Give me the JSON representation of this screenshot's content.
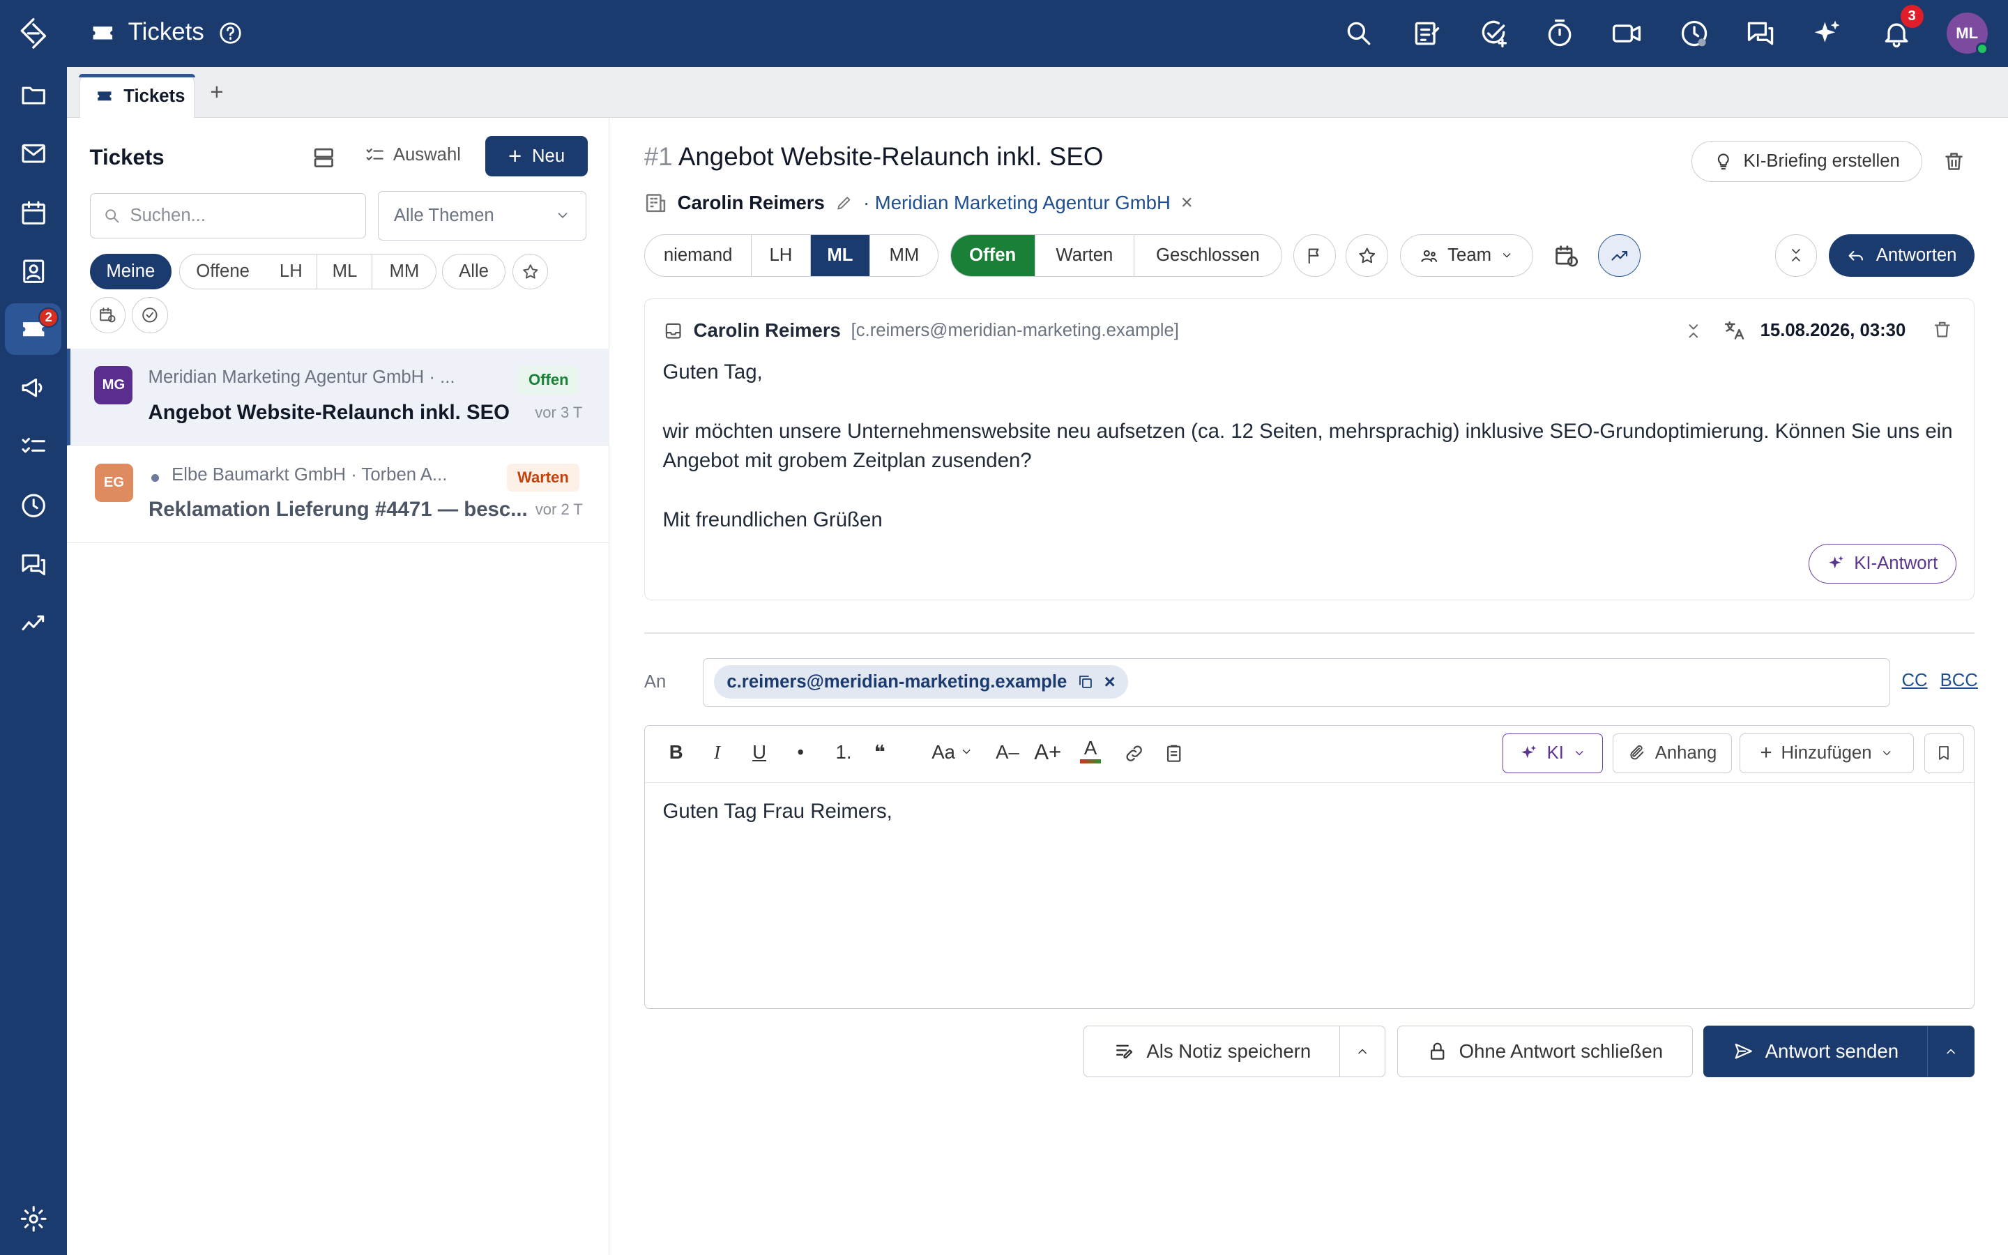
{
  "app": {
    "title": "Tickets",
    "notification_count": "3",
    "user_initials": "ML",
    "sidebar_ticket_badge": "2"
  },
  "tabs": [
    {
      "label": "Tickets"
    }
  ],
  "left": {
    "heading": "Tickets",
    "auswahl_label": "Auswahl",
    "new_label": "Neu",
    "search_placeholder": "Suchen...",
    "themen_select": "Alle Themen",
    "filters": [
      "Meine",
      "Offene",
      "LH",
      "ML",
      "MM",
      "Alle"
    ],
    "tickets": [
      {
        "initials": "MG",
        "meta": "Meridian Marketing Agentur GmbH · ...",
        "title": "Angebot Website-Relaunch inkl. SEO",
        "status": "Offen",
        "time": "vor 3 T"
      },
      {
        "initials": "EG",
        "meta": "Elbe Baumarkt GmbH · Torben A...",
        "title": "Reklamation Lieferung #4471 — besc...",
        "status": "Warten",
        "time": "vor 2 T"
      }
    ]
  },
  "ticket": {
    "number": "#1",
    "title": "Angebot Website-Relaunch inkl. SEO",
    "ki_briefing": "KI-Briefing erstellen",
    "contact": "Carolin Reimers",
    "company": "· Meridian Marketing Agentur GmbH",
    "assignees": [
      "niemand",
      "LH",
      "ML",
      "MM"
    ],
    "assignee_selected": "ML",
    "statuses": [
      "Offen",
      "Warten",
      "Geschlossen"
    ],
    "status_selected": "Offen",
    "team_label": "Team",
    "reply_label": "Antworten"
  },
  "mail": {
    "from_name": "Carolin Reimers",
    "from_addr": "[c.reimers@meridian-marketing.example]",
    "date": "15.08.2026, 03:30",
    "body": [
      "Guten Tag,",
      "wir möchten unsere Unternehmenswebsite neu aufsetzen (ca. 12 Seiten, mehrsprachig) inklusive SEO-Grundoptimierung. Können Sie uns ein Angebot mit grobem Zeitplan zusenden?",
      "Mit freundlichen Grüßen"
    ],
    "ki_antwort": "KI-Antwort"
  },
  "compose": {
    "to_label": "An",
    "to_chip": "c.reimers@meridian-marketing.example",
    "cc": "CC",
    "bcc": "BCC",
    "toolbar": {
      "bold": "B",
      "italic": "I",
      "underline": "U",
      "bullet": "•",
      "numbered": "1.",
      "quote": "❝",
      "font_size": "Aa",
      "smaller": "A–",
      "larger": "A+",
      "color": "A",
      "ki": "KI",
      "anhang": "Anhang",
      "hinzufuegen": "Hinzufügen"
    },
    "body": "Guten Tag Frau Reimers,"
  },
  "actions": {
    "note": "Als Notiz speichern",
    "close": "Ohne Antwort schließen",
    "send": "Antwort senden"
  },
  "colors": {
    "brand": "#1b3b6f",
    "status_open": "#1a7f37",
    "status_wait": "#c2410c",
    "ki_purple": "#5b3590"
  }
}
